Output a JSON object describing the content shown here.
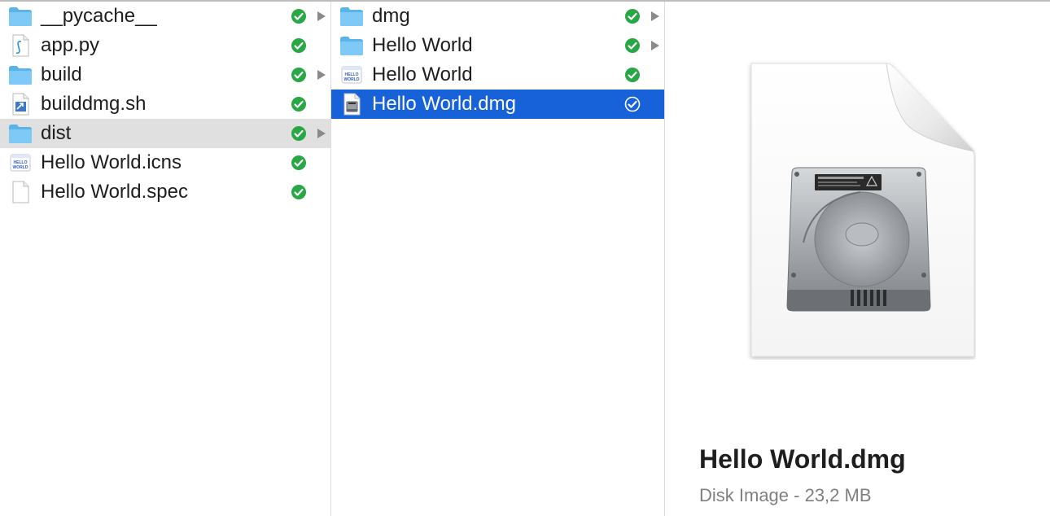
{
  "column1": {
    "items": [
      {
        "name": "__pycache__",
        "icon": "folder-icon",
        "synced": true,
        "expandable": true
      },
      {
        "name": "app.py",
        "icon": "python-file-icon",
        "synced": true,
        "expandable": false
      },
      {
        "name": "build",
        "icon": "folder-icon",
        "synced": true,
        "expandable": true
      },
      {
        "name": "builddmg.sh",
        "icon": "shell-script-icon",
        "synced": true,
        "expandable": false
      },
      {
        "name": "dist",
        "icon": "folder-icon",
        "synced": true,
        "expandable": true,
        "active": true
      },
      {
        "name": "Hello World.icns",
        "icon": "icns-file-icon",
        "synced": true,
        "expandable": false
      },
      {
        "name": "Hello World.spec",
        "icon": "document-icon",
        "synced": true,
        "expandable": false
      }
    ]
  },
  "column2": {
    "items": [
      {
        "name": "dmg",
        "icon": "folder-icon",
        "synced": true,
        "expandable": true
      },
      {
        "name": "Hello World",
        "icon": "folder-icon",
        "synced": true,
        "expandable": true
      },
      {
        "name": "Hello World",
        "icon": "app-icon",
        "synced": true,
        "expandable": false
      },
      {
        "name": "Hello World.dmg",
        "icon": "disk-image-icon",
        "synced": true,
        "expandable": false,
        "selected": true
      }
    ]
  },
  "preview": {
    "name": "Hello World.dmg",
    "meta": "Disk Image - 23,2 MB",
    "icon": "hard-drive-icon"
  },
  "colors": {
    "selection": "#1862d9",
    "active_row": "#e0e0e0",
    "sync_check": "#28a745",
    "folder": "#6cc1f2"
  }
}
